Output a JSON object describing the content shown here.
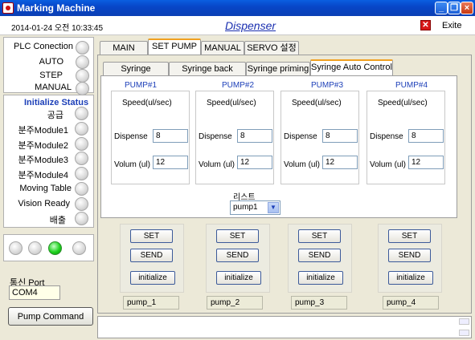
{
  "window": {
    "title": "Marking Machine"
  },
  "header": {
    "datetime": "2014-01-24 오전 10:33:45",
    "title": "Dispenser",
    "exit_label": "Exite"
  },
  "status": {
    "plc_label": "PLC Conection",
    "modes": [
      "AUTO",
      "STEP",
      "MANUAL"
    ],
    "init_title": "Initialize  Status",
    "init_items": [
      "공급",
      "분주Module1",
      "분주Module2",
      "분주Module3",
      "분주Module4",
      "Moving Table",
      "Vision Ready",
      "배출"
    ],
    "indicator_colors": [
      "#d8d8d8",
      "#d8d8d8",
      "#1ed21e",
      "#d8d8d8"
    ]
  },
  "port": {
    "label": "통신 Port",
    "value": "COM4"
  },
  "pump_command_label": "Pump Command",
  "tabs": [
    "MAIN",
    "SET PUMP",
    "MANUAL",
    "SERVO 설정"
  ],
  "subtabs": [
    "Syringe Washing",
    "Syringe back pump",
    "Syringe priming",
    "Syringe Auto Control"
  ],
  "pumps": [
    {
      "title": "PUMP#1",
      "speed_label": "Speed(ul/sec)",
      "dispense_label": "Dispense",
      "dispense": "8",
      "volum_label": "Volum (ul)",
      "volum": "12"
    },
    {
      "title": "PUMP#2",
      "speed_label": "Speed(ul/sec)",
      "dispense_label": "Dispense",
      "dispense": "8",
      "volum_label": "Volum (ul)",
      "volum": "12"
    },
    {
      "title": "PUMP#3",
      "speed_label": "Speed(ul/sec)",
      "dispense_label": "Dispense",
      "dispense": "8",
      "volum_label": "Volum (ul)",
      "volum": "12"
    },
    {
      "title": "PUMP#4",
      "speed_label": "Speed(ul/sec)",
      "dispense_label": "Dispense",
      "dispense": "8",
      "volum_label": "Volum (ul)",
      "volum": "12"
    }
  ],
  "list": {
    "label": "리스트",
    "selected": "pump1"
  },
  "pump_controls": [
    {
      "set": "SET",
      "send": "SEND",
      "init": "initialize",
      "name": "pump_1"
    },
    {
      "set": "SET",
      "send": "SEND",
      "init": "initialize",
      "name": "pump_2"
    },
    {
      "set": "SET",
      "send": "SEND",
      "init": "initialize",
      "name": "pump_3"
    },
    {
      "set": "SET",
      "send": "SEND",
      "init": "initialize",
      "name": "pump_4"
    }
  ]
}
